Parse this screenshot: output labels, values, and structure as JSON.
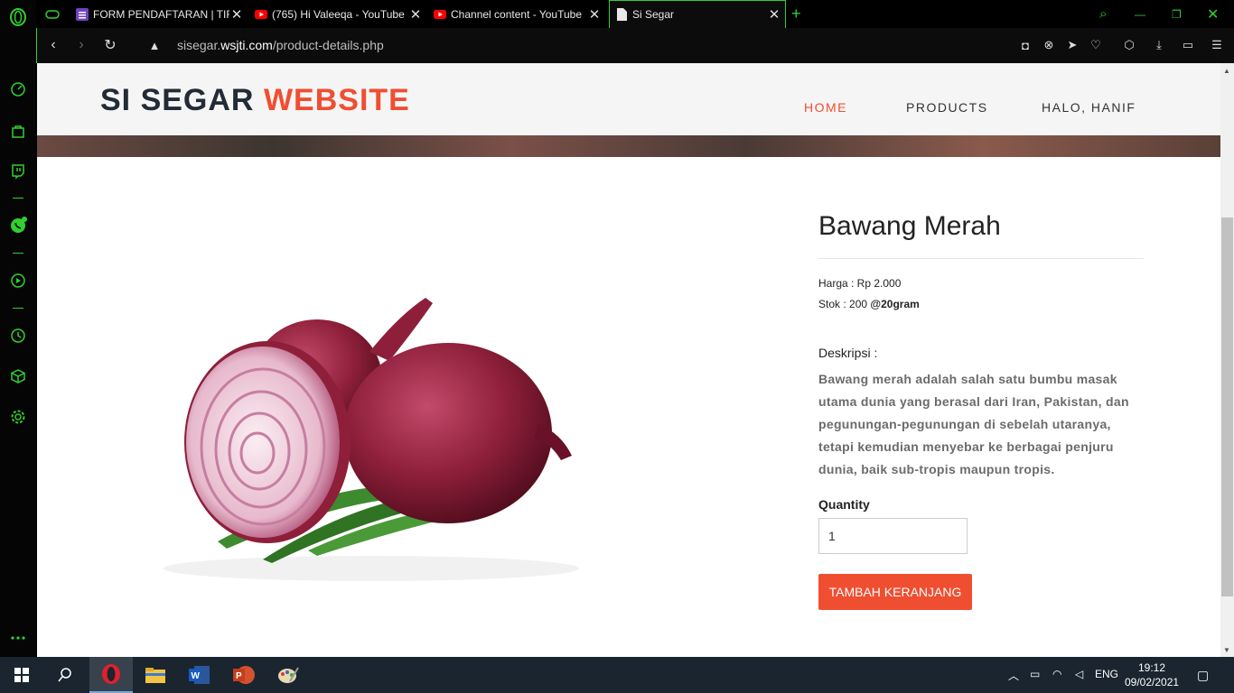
{
  "browser": {
    "tabs": [
      {
        "title": "FORM PENDAFTARAN | TIF",
        "icon": "forms-icon"
      },
      {
        "title": "(765) Hi Valeeqa - YouTube",
        "icon": "youtube-icon"
      },
      {
        "title": "Channel content - YouTube",
        "icon": "youtube-icon"
      },
      {
        "title": "Si Segar",
        "icon": "document-icon"
      }
    ],
    "url_prefix": "sisegar.",
    "url_domain": "wsjti.com",
    "url_path": "/product-details.php"
  },
  "site": {
    "logo_main": "SI SEGAR",
    "logo_accent": "WEBSITE",
    "nav": [
      "HOME",
      "PRODUCTS",
      "HALO, HANIF"
    ]
  },
  "product": {
    "name": "Bawang Merah",
    "price_label": "Harga : Rp 2.000",
    "stock_label": "Stok : 200",
    "stock_unit": "@20gram",
    "desc_label": "Deskripsi :",
    "description": "Bawang merah adalah salah satu bumbu masak utama dunia yang berasal dari Iran, Pakistan, dan pegunungan-pegunungan di sebelah utaranya, tetapi kemudian menyebar ke berbagai penjuru dunia, baik sub-tropis maupun tropis.",
    "quantity_label": "Quantity",
    "quantity_value": "1",
    "add_to_cart": "TAMBAH KERANJANG"
  },
  "taskbar": {
    "language": "ENG",
    "time": "19:12",
    "date": "09/02/2021"
  },
  "colors": {
    "accent": "#f04e31",
    "browser_accent": "#2fd12f",
    "navy": "#222b36"
  }
}
